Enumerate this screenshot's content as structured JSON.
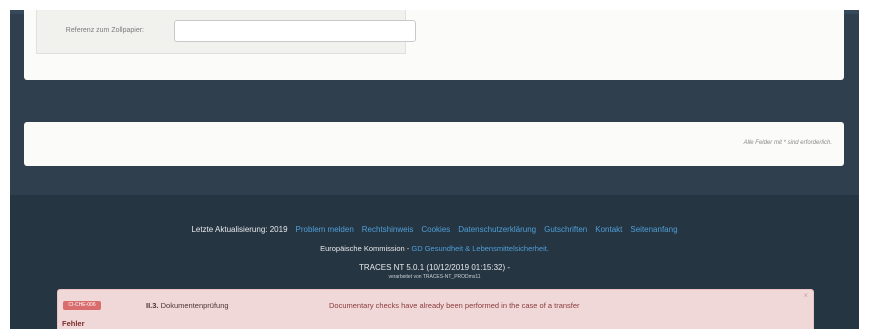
{
  "form": {
    "customs_reference_label": "Referenz zum Zollpapier:",
    "customs_reference_value": "",
    "customs_reference_placeholder": ""
  },
  "notice": {
    "required_fields_text": "Alle Felder mit * sind erforderlich."
  },
  "footer": {
    "last_updated": "Letzte Aktualisierung: 2019",
    "links": [
      "Problem melden",
      "Rechtshinweis",
      "Cookies",
      "Datenschutzerklärung",
      "Gutschriften",
      "Kontakt",
      "Seitenanfang"
    ],
    "commission_text": "Europäische Kommission - ",
    "commission_link": "GD Gesundheit & Lebensmittelsicherheit.",
    "version": "TRACES NT 5.0.1 (10/12/2019 01:15:32) -",
    "processed_by": "verarbeitet von TRACES-NT_PRODms11"
  },
  "error": {
    "code_badge": "CI-CHE-006",
    "section_number": "II.3.",
    "section_title": "Dokumentenprüfung",
    "message": "Documentary checks have already been performed in the case of a transfer",
    "close_symbol": "×",
    "heading": "Fehler"
  },
  "colors": {
    "page_background": "#2f3f4d",
    "footer_background": "#263542",
    "link": "#4e9fd8",
    "error_background": "#f1d8d8",
    "error_badge": "#d96d6d"
  },
  "icons": {
    "close": "close-icon"
  }
}
